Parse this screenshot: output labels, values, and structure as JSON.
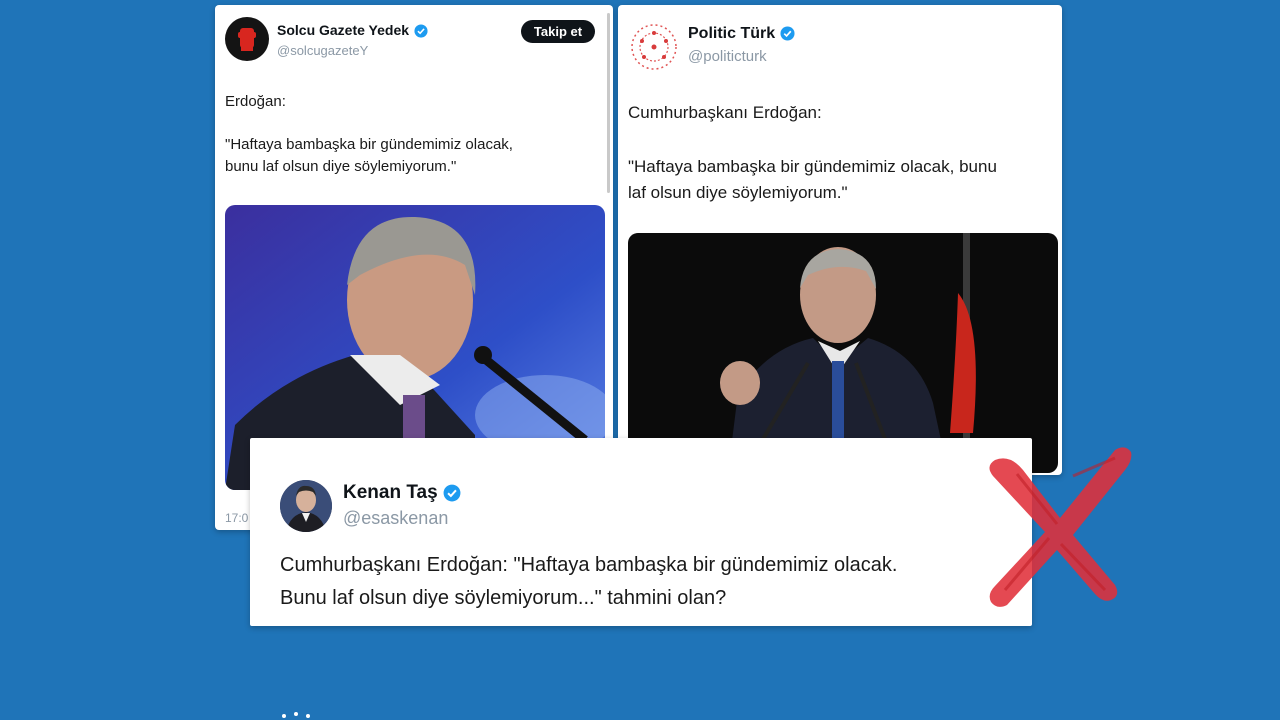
{
  "left_tweet": {
    "name": "Solcu Gazete Yedek",
    "handle": "@solcugazeteY",
    "follow_label": "Takip et",
    "line1": "Erdoğan:",
    "quote1": "\"Haftaya bambaşka bir gündemimiz olacak,",
    "quote2": "bunu laf olsun diye söylemiyorum.\"",
    "time": "17:0"
  },
  "right_tweet": {
    "name": "Politic Türk",
    "handle": "@politicturk",
    "line1": "Cumhurbaşkanı Erdoğan:",
    "quote1": "\"Haftaya bambaşka bir gündemimiz olacak, bunu",
    "quote2": "laf olsun diye söylemiyorum.\""
  },
  "bottom_tweet": {
    "name": "Kenan Taş",
    "handle": "@esaskenan",
    "line1": "Cumhurbaşkanı Erdoğan: \"Haftaya bambaşka bir gündemimiz olacak.",
    "line2": "Bunu laf olsun diye söylemiyorum...\" tahmini olan?"
  },
  "icons": [
    "verified-badge-icon",
    "red-x-mark-icon"
  ],
  "colors": {
    "background": "#1f74b8",
    "verified": "#1d9bf0",
    "follow_button": "#0f1419",
    "x_mark": "#e0303a"
  }
}
